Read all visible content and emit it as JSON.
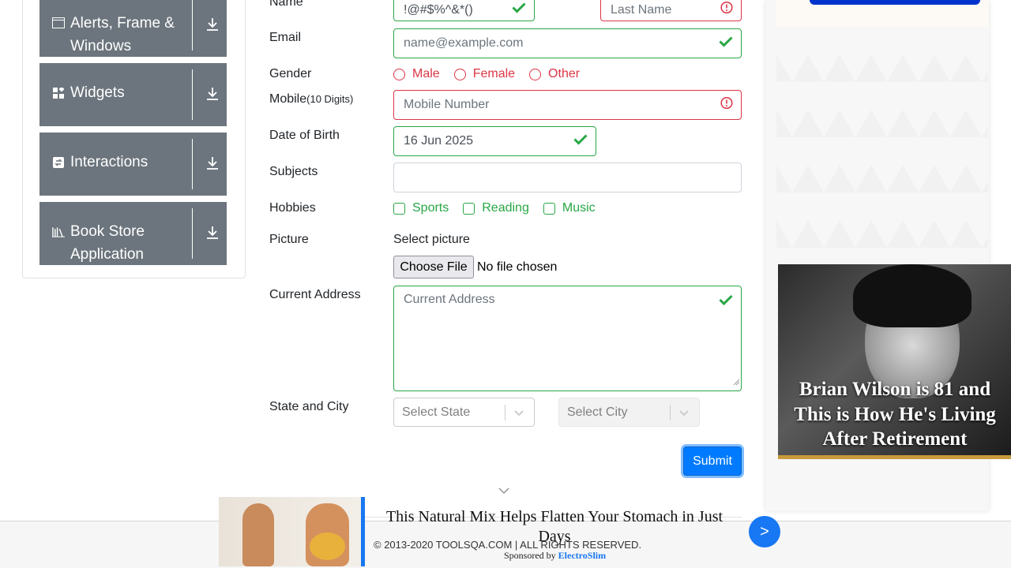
{
  "sidebar": {
    "groups": [
      {
        "label": "Alerts, Frame & Windows",
        "icon": "window-icon"
      },
      {
        "label": "Widgets",
        "icon": "widgets-icon"
      },
      {
        "label": "Interactions",
        "icon": "interactions-icon"
      },
      {
        "label": "Book Store Application",
        "icon": "book-icon"
      }
    ]
  },
  "form": {
    "name_label": "Name",
    "first_name_value": "!@#$%^&*()",
    "last_name_placeholder": "Last Name",
    "email_label": "Email",
    "email_placeholder": "name@example.com",
    "gender_label": "Gender",
    "gender_options": [
      "Male",
      "Female",
      "Other"
    ],
    "mobile_label": "Mobile",
    "mobile_hint": "(10 Digits)",
    "mobile_placeholder": "Mobile Number",
    "dob_label": "Date of Birth",
    "dob_value": "16 Jun 2025",
    "subjects_label": "Subjects",
    "hobbies_label": "Hobbies",
    "hobbies_options": [
      "Sports",
      "Reading",
      "Music"
    ],
    "picture_label": "Picture",
    "picture_select_text": "Select picture",
    "choose_file_label": "Choose File",
    "no_file_text": "No file chosen",
    "address_label": "Current Address",
    "address_placeholder": "Current Address",
    "state_city_label": "State and City",
    "state_placeholder": "Select State",
    "city_placeholder": "Select City",
    "submit_label": "Submit"
  },
  "ads": {
    "right_headline": "Brian Wilson is 81 and This is How He's Living After Retirement",
    "bottom_title": "This Natural Mix Helps Flatten Your Stomach in Just Days",
    "sponsored_by": "Sponsored by",
    "sponsor_brand": "ElectroSlim",
    "next_symbol": ">"
  },
  "footer": {
    "copyright": "© 2013-2020 TOOLSQA.COM | ALL RIGHTS RESERVED."
  },
  "colors": {
    "valid": "#28a745",
    "invalid": "#dc3545",
    "primary": "#007bff",
    "sidebar_group": "#6c757d"
  }
}
